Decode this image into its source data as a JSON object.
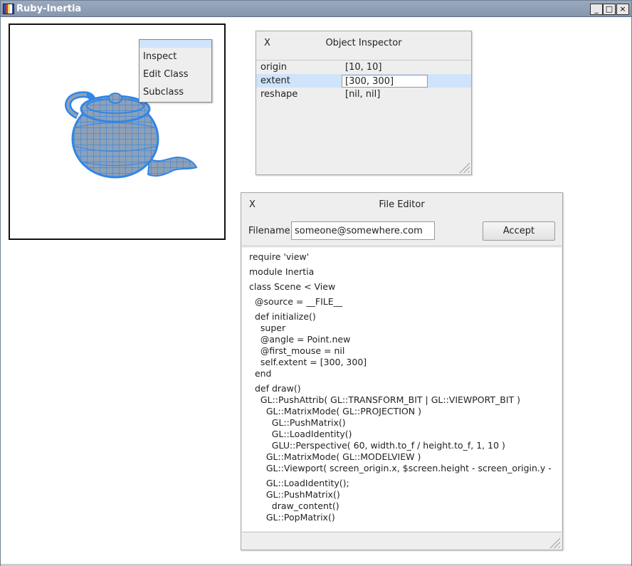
{
  "window": {
    "title": "Ruby-Inertia",
    "min_glyph": "_",
    "max_glyph": "□",
    "close_glyph": "×"
  },
  "context_menu": {
    "items": [
      "Inspect",
      "Edit Class",
      "Subclass"
    ]
  },
  "inspector": {
    "close_label": "X",
    "title": "Object Inspector",
    "properties": [
      {
        "name": "origin",
        "value": "[10, 10]"
      },
      {
        "name": "extent",
        "value": "[300, 300]"
      },
      {
        "name": "reshape",
        "value": "[nil, nil]"
      }
    ]
  },
  "editor": {
    "close_label": "X",
    "title": "File Editor",
    "filename_label": "Filename",
    "filename_value": "someone@somewhere.com",
    "accept_label": "Accept",
    "code": [
      "require 'view'",
      "module Inertia",
      "class Scene < View",
      "  @source = __FILE__",
      "  def initialize()",
      "    super",
      "    @angle = Point.new",
      "    @first_mouse = nil",
      "    self.extent = [300, 300]",
      "  end",
      "  def draw()",
      "    GL::PushAttrib( GL::TRANSFORM_BIT | GL::VIEWPORT_BIT )",
      "      GL::MatrixMode( GL::PROJECTION )",
      "        GL::PushMatrix()",
      "        GL::LoadIdentity()",
      "        GLU::Perspective( 60, width.to_f / height.to_f, 1, 10 )",
      "      GL::MatrixMode( GL::MODELVIEW )",
      "      GL::Viewport( screen_origin.x, $screen.height - screen_origin.y -",
      "      GL::LoadIdentity();",
      "      GL::PushMatrix()",
      "        draw_content()",
      "      GL::PopMatrix()"
    ]
  },
  "colors": {
    "titlebar": "#8596ad",
    "selection": "#cfe3fb",
    "teapot_fill": "#8fa0b6",
    "teapot_wire": "#2f86e6"
  }
}
